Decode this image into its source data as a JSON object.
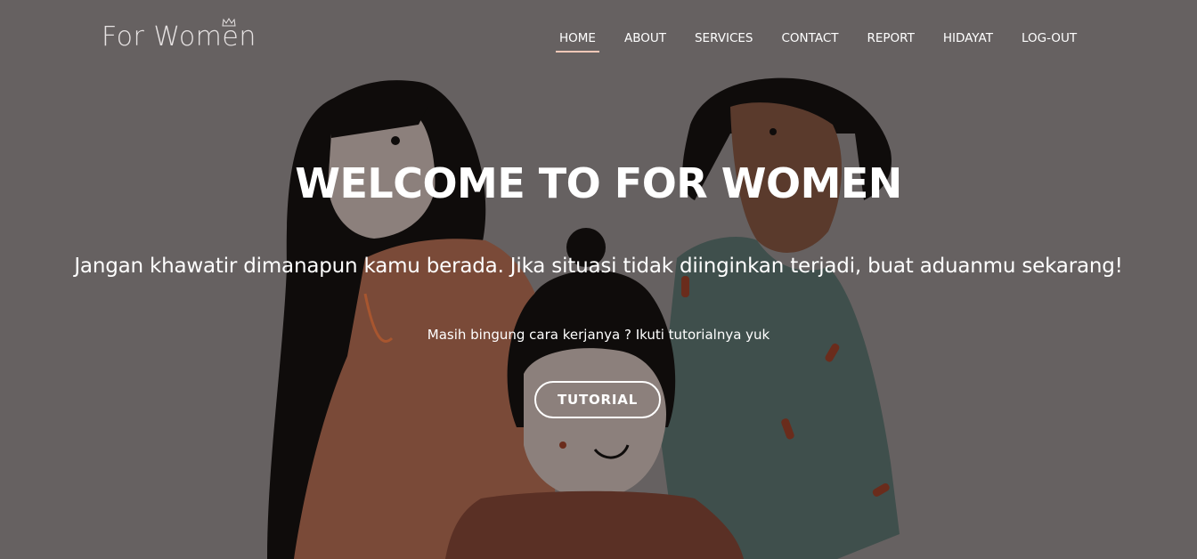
{
  "brand": {
    "logo_text": "For Women"
  },
  "nav": {
    "items": [
      {
        "label": "HOME",
        "active": true
      },
      {
        "label": "ABOUT",
        "active": false
      },
      {
        "label": "SERVICES",
        "active": false
      },
      {
        "label": "CONTACT",
        "active": false
      },
      {
        "label": "REPORT",
        "active": false
      },
      {
        "label": "HIDAYAT",
        "active": false
      },
      {
        "label": "LOG-OUT",
        "active": false
      }
    ]
  },
  "hero": {
    "title": "WELCOME TO FOR WOMEN",
    "subtitle": "Jangan khawatir dimanapun kamu berada. Jika situasi tidak diinginkan terjadi, buat aduanmu sekarang!",
    "hint": "Masih bingung cara kerjanya ? Ikuti tutorialnya yuk",
    "button_label": "TUTORIAL"
  },
  "colors": {
    "background": "#666161",
    "text": "#ffffff",
    "nav_active_underline": "#f4c8b8",
    "shirt_left": "#7a4a38",
    "shirt_right": "#3f4f4c",
    "shirt_center": "#5a3025"
  }
}
